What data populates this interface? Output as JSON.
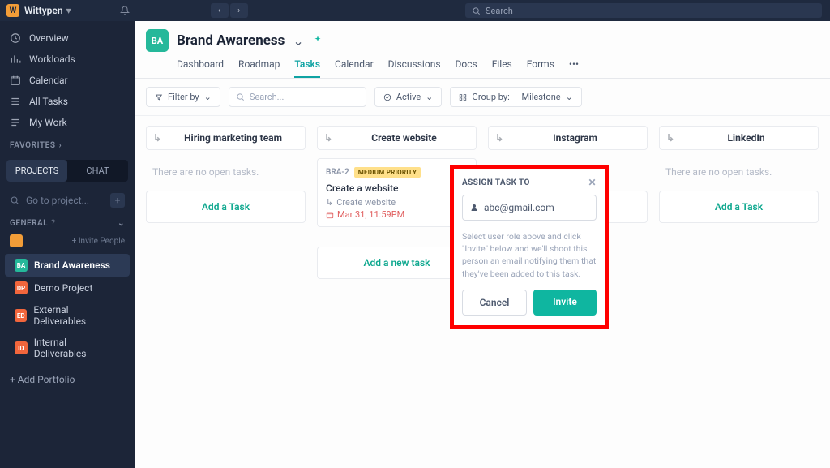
{
  "topbar": {
    "brand": "Wittypen",
    "search_placeholder": "Search"
  },
  "sidebar": {
    "nav": [
      {
        "label": "Overview"
      },
      {
        "label": "Workloads"
      },
      {
        "label": "Calendar"
      },
      {
        "label": "All Tasks"
      },
      {
        "label": "My Work"
      }
    ],
    "favorites_label": "FAVORITES",
    "tabs": {
      "projects": "PROJECTS",
      "chat": "CHAT"
    },
    "goto_placeholder": "Go to project...",
    "general_label": "GENERAL",
    "invite_label": "+ Invite People",
    "projects": [
      {
        "code": "BA",
        "color": "#25b89a",
        "name": "Brand Awareness",
        "active": true
      },
      {
        "code": "DP",
        "color": "#f2663c",
        "name": "Demo Project"
      },
      {
        "code": "ED",
        "color": "#f2663c",
        "name": "External Deliverables"
      },
      {
        "code": "ID",
        "color": "#f2663c",
        "name": "Internal Deliverables"
      }
    ],
    "add_portfolio": "+ Add Portfolio"
  },
  "header": {
    "avatar": "BA",
    "title": "Brand Awareness",
    "tabs": [
      "Dashboard",
      "Roadmap",
      "Tasks",
      "Calendar",
      "Discussions",
      "Docs",
      "Files",
      "Forms"
    ],
    "selected_tab": 2
  },
  "toolbar": {
    "filter": "Filter by",
    "search_placeholder": "Search...",
    "status": "Active",
    "groupby_label": "Group by:",
    "groupby_value": "Milestone"
  },
  "board": {
    "empty_text": "There are no open tasks.",
    "add_task": "Add a Task",
    "add_new_task": "Add a new task",
    "columns": [
      {
        "title": "Hiring marketing team"
      },
      {
        "title": "Create website",
        "card": {
          "id": "BRA-2",
          "priority": "MEDIUM PRIORITY",
          "title": "Create a website",
          "subtask": "Create website",
          "date": "Mar 31, 11:59PM"
        }
      },
      {
        "title": "Instagram"
      },
      {
        "title": "LinkedIn"
      }
    ]
  },
  "popover": {
    "title": "ASSIGN TASK TO",
    "email": "abc@gmail.com",
    "hint": "Select user role above and click \"Invite\" below and we'll shoot this person an email notifying them that they've been added to this task.",
    "cancel": "Cancel",
    "invite": "Invite"
  }
}
